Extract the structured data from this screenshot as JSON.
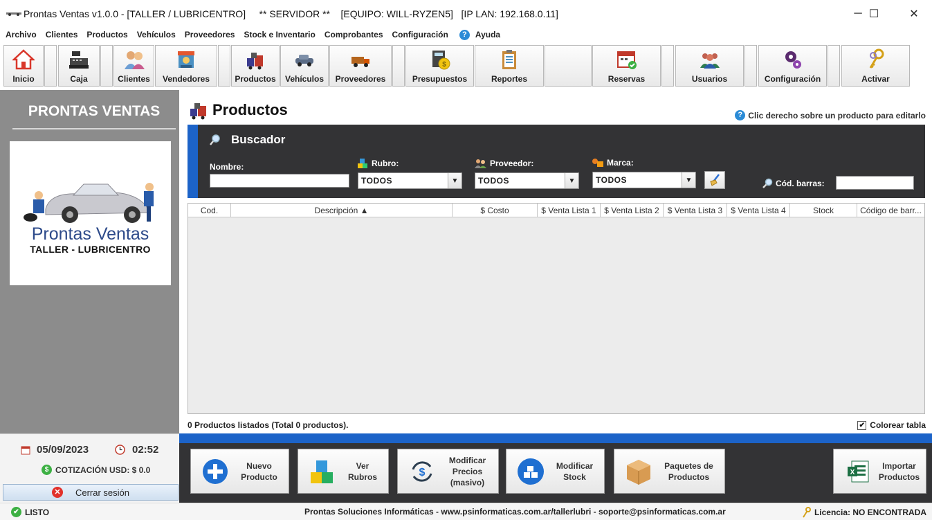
{
  "window": {
    "title": "Prontas Ventas v1.0.0 - [TALLER / LUBRICENTRO]     ** SERVIDOR **    [EQUIPO: WILL-RYZEN5]   [IP LAN: 192.168.0.11]",
    "minimize": "─",
    "maximize": "☐",
    "close": "✕"
  },
  "menu": [
    "Archivo",
    "Clientes",
    "Productos",
    "Vehículos",
    "Proveedores",
    "Stock e Inventario",
    "Comprobantes",
    "Configuración",
    "Ayuda"
  ],
  "toolbar": {
    "inicio": "Inicio",
    "caja": "Caja",
    "clientes": "Clientes",
    "vendedores": "Vendedores",
    "productos": "Productos",
    "vehiculos": "Vehículos",
    "proveedores": "Proveedores",
    "presupuestos": "Presupuestos",
    "reportes": "Reportes",
    "reservas": "Reservas",
    "usuarios": "Usuarios",
    "configuracion": "Configuración",
    "activar": "Activar"
  },
  "sidebar": {
    "brand": "PRONTAS VENTAS",
    "logo_name": "Prontas Ventas",
    "logo_sub": "TALLER - LUBRICENTRO",
    "date": "05/09/2023",
    "time": "02:52",
    "cotizacion": "COTIZACIÓN USD: $ 0.0",
    "logout": "Cerrar sesión"
  },
  "main": {
    "title": "Productos",
    "hint": "Clic derecho sobre un producto para editarlo",
    "search": {
      "heading": "Buscador",
      "nombre_label": "Nombre:",
      "nombre_value": "",
      "rubro_label": "Rubro:",
      "rubro_value": "TODOS",
      "proveedor_label": "Proveedor:",
      "proveedor_value": "TODOS",
      "marca_label": "Marca:",
      "marca_value": "TODOS",
      "barcode_label": "Cód. barras:",
      "barcode_value": ""
    },
    "table": {
      "columns": [
        "Cod.",
        "Descripción ▲",
        "$ Costo",
        "$ Venta Lista 1",
        "$ Venta Lista 2",
        "$ Venta Lista 3",
        "$ Venta Lista 4",
        "Stock",
        "Código de barr..."
      ],
      "rows": []
    },
    "count": "0 Productos listados (Total 0 productos).",
    "colorear": "Colorear tabla",
    "colorear_checked": true
  },
  "actions": {
    "nuevo": "Nuevo\nProducto",
    "rubros": "Ver\nRubros",
    "precios": "Modificar\nPrecios\n(masivo)",
    "stock": "Modificar\nStock",
    "paquetes": "Paquetes de\nProductos",
    "importar": "Importar\nProductos"
  },
  "status": {
    "state": "LISTO",
    "company": "Prontas Soluciones Informáticas  - www.psinformaticas.com.ar/tallerlubri - soporte@psinformaticas.com.ar",
    "license": "Licencia: NO ENCONTRADA"
  },
  "colors": {
    "accent_blue": "#1c63c8",
    "dark_panel": "#333335",
    "sidebar_gray": "#8c8c8c"
  }
}
